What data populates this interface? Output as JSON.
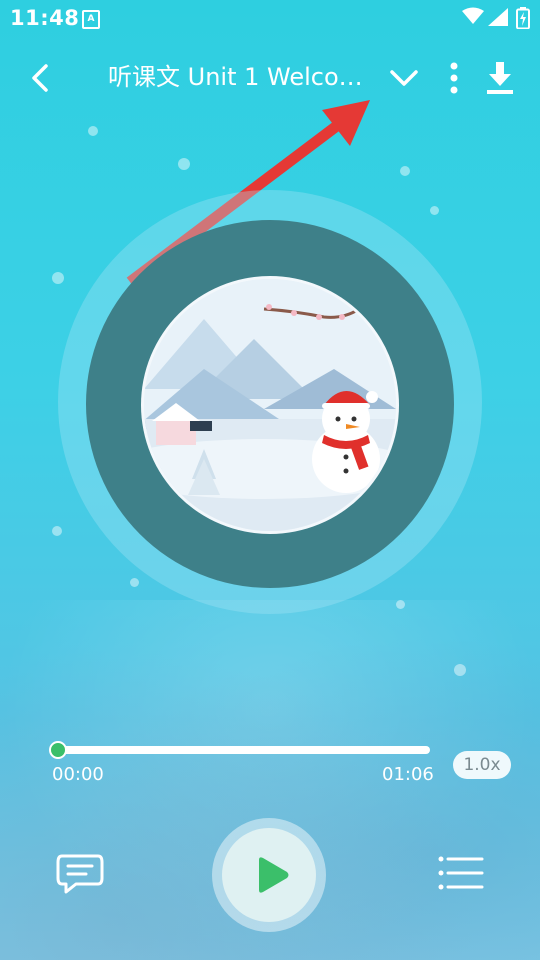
{
  "status_bar": {
    "time": "11:48",
    "app_badge": "A"
  },
  "header": {
    "title": "听课文 Unit 1 Welcom..."
  },
  "player": {
    "current_time": "00:00",
    "total_time": "01:06",
    "speed": "1.0x",
    "progress": 0.0
  },
  "colors": {
    "accent": "#3bbf6a",
    "disc": "#3e8089",
    "annotation_arrow": "#e53935"
  },
  "icons": {
    "back": "chevron-left-icon",
    "dropdown": "chevron-down-icon",
    "more": "more-vertical-icon",
    "download": "download-icon",
    "subtitle": "subtitle-bubble-icon",
    "play": "play-icon",
    "playlist": "playlist-icon"
  }
}
